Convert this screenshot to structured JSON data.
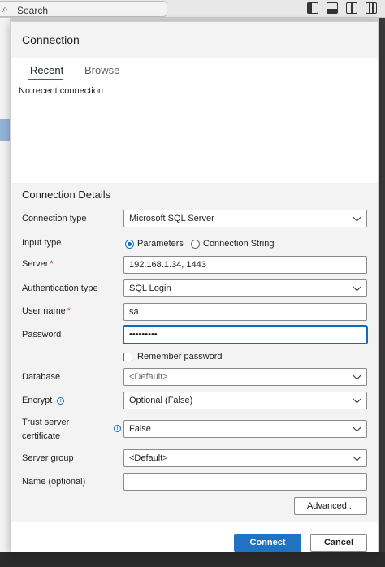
{
  "topbar": {
    "search_label": "Search"
  },
  "dialog": {
    "title": "Connection",
    "tabs": [
      {
        "label": "Recent"
      },
      {
        "label": "Browse"
      }
    ],
    "recent_empty_text": "No recent connection",
    "details_title": "Connection Details",
    "fields": {
      "connection_type": {
        "label": "Connection type",
        "value": "Microsoft SQL Server"
      },
      "input_type": {
        "label": "Input type",
        "options": [
          "Parameters",
          "Connection String"
        ],
        "selected": "Parameters"
      },
      "server": {
        "label": "Server",
        "required_mark": "*",
        "value": "192.168.1.34, 1443"
      },
      "auth_type": {
        "label": "Authentication type",
        "value": "SQL Login"
      },
      "user_name": {
        "label": "User name",
        "required_mark": "*",
        "value": "sa"
      },
      "password": {
        "label": "Password",
        "value": "•••••••••"
      },
      "remember_password": {
        "label": "Remember password",
        "checked": false
      },
      "database": {
        "label": "Database",
        "value": "<Default>"
      },
      "encrypt": {
        "label": "Encrypt",
        "value": "Optional (False)"
      },
      "trust_server_cert": {
        "label_line1": "Trust server",
        "label_line2": "certificate",
        "value": "False"
      },
      "server_group": {
        "label": "Server group",
        "value": "<Default>"
      },
      "name_optional": {
        "label": "Name (optional)",
        "value": ""
      }
    },
    "buttons": {
      "advanced": "Advanced...",
      "connect": "Connect",
      "cancel": "Cancel"
    },
    "colors": {
      "accent": "#0f6cbd",
      "primary_button": "#1f73c2",
      "required": "#c42b1c"
    }
  }
}
